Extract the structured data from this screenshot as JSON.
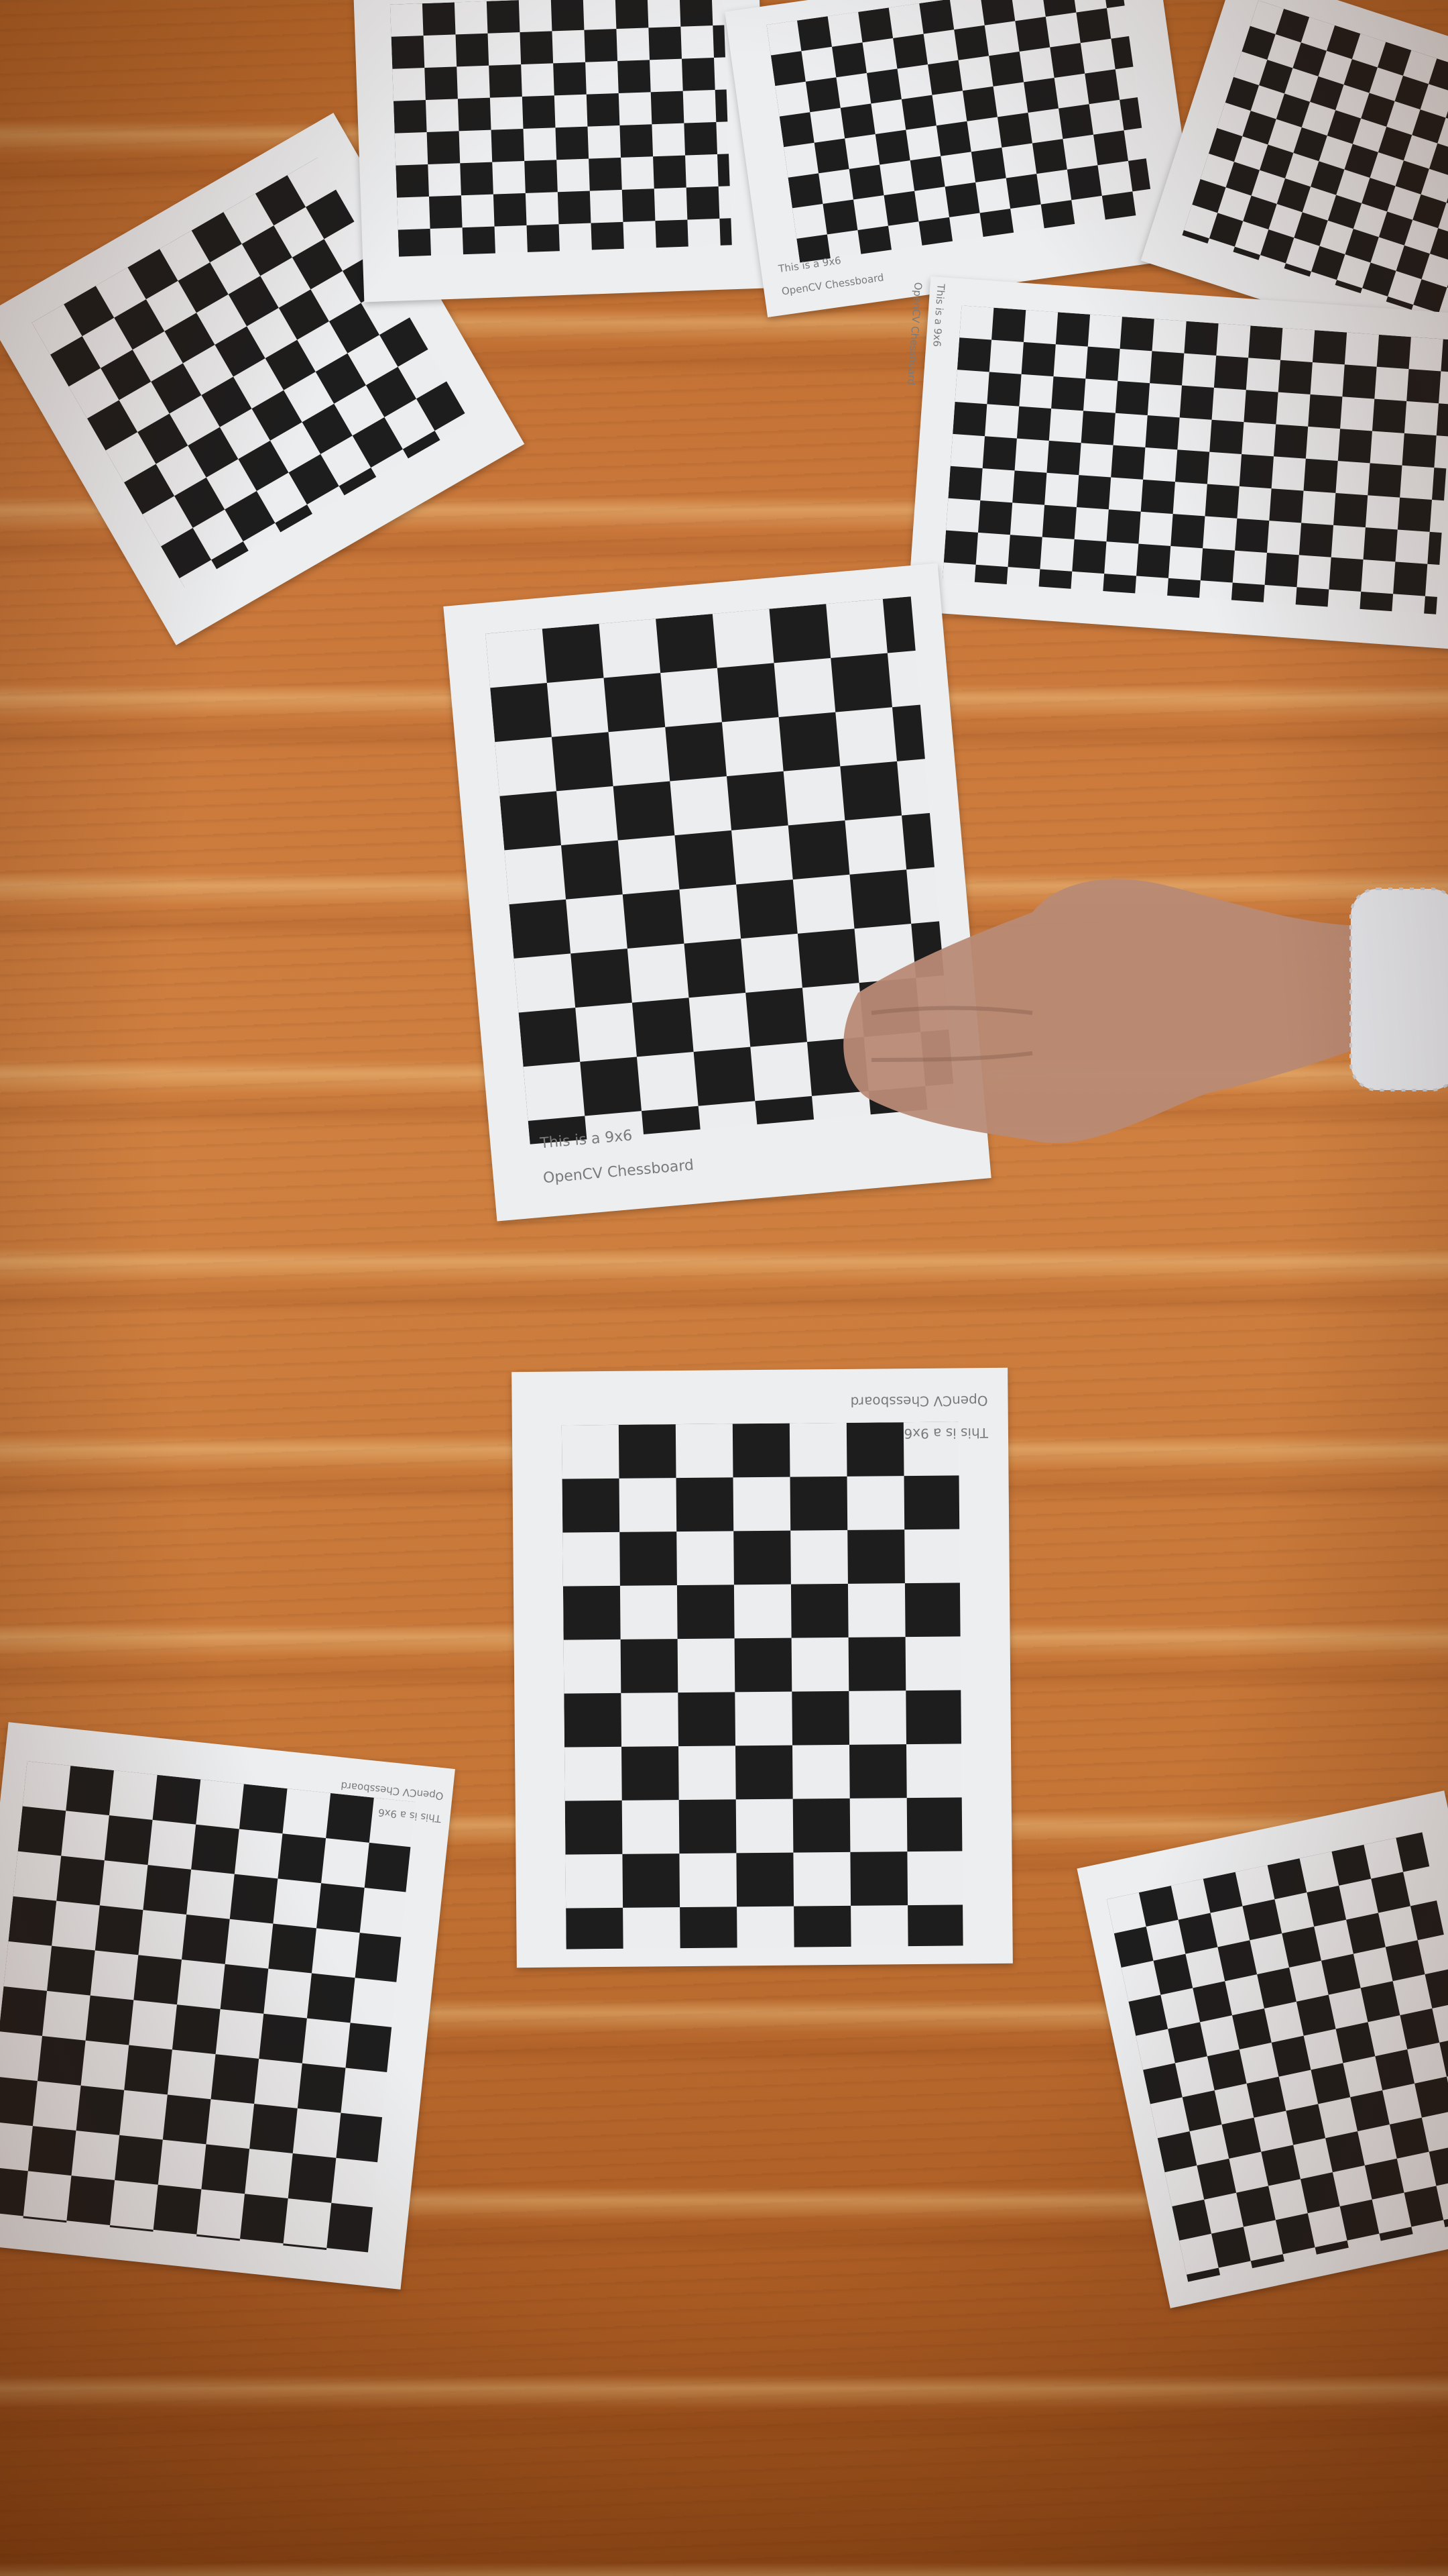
{
  "scene": {
    "description_tag": "",
    "sheet_caption": {
      "line1": "This is a 9x6",
      "line2": "OpenCV Chessboard"
    },
    "colors": {
      "wood": "#c9773a",
      "paper": "#eceef0",
      "square_dark": "#1d1d1d"
    }
  }
}
